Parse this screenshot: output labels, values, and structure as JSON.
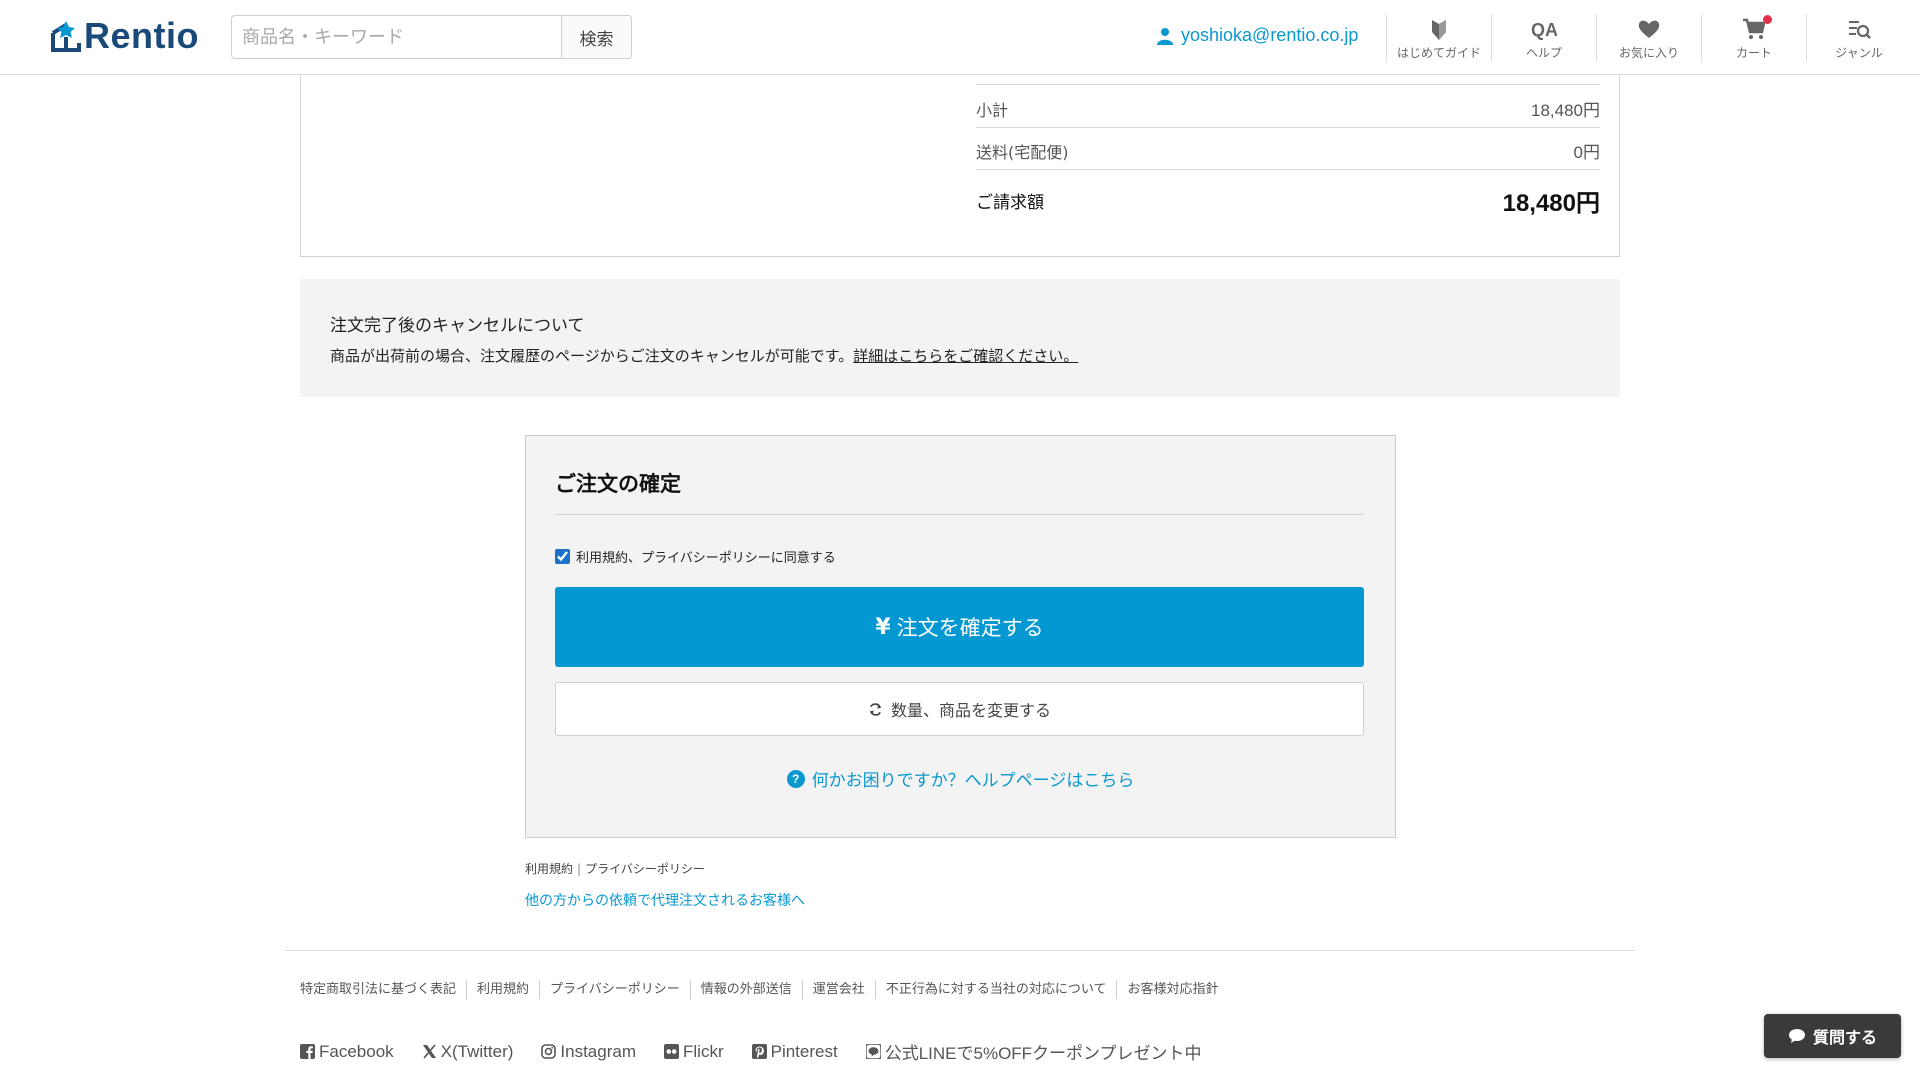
{
  "header": {
    "logo_text": "Rentio",
    "search_placeholder": "商品名・キーワード",
    "search_button": "検索",
    "user_email": "yoshioka@rentio.co.jp",
    "nav": [
      {
        "label": "はじめてガイド",
        "icon": "beginner-guide-icon"
      },
      {
        "label": "ヘルプ",
        "icon": "qa-icon"
      },
      {
        "label": "お気に入り",
        "icon": "heart-icon"
      },
      {
        "label": "カート",
        "icon": "cart-icon"
      },
      {
        "label": "ジャンル",
        "icon": "genre-search-icon"
      }
    ]
  },
  "summary": {
    "subtotal_label": "小計",
    "subtotal_value": "18,480円",
    "shipping_label": "送料(宅配便)",
    "shipping_value": "0円",
    "total_label": "ご請求額",
    "total_value": "18,480円"
  },
  "notice": {
    "title": "注文完了後のキャンセルについて",
    "text": "商品が出荷前の場合、注文履歴のページからご注文のキャンセルが可能です。",
    "link": "詳細はこちらをご確認ください。"
  },
  "confirm": {
    "title": "ご注文の確定",
    "agree_label": "利用規約、プライバシーポリシーに同意する",
    "agree_checked": true,
    "confirm_button": "注文を確定する",
    "change_button": "数量、商品を変更する",
    "help_link": "何かお困りですか？ヘルプページはこちら"
  },
  "terms": {
    "terms_link": "利用規約",
    "privacy_link": "プライバシーポリシー",
    "proxy_link": "他の方からの依頼で代理注文されるお客様へ"
  },
  "footer": {
    "links": [
      "特定商取引法に基づく表記",
      "利用規約",
      "プライバシーポリシー",
      "情報の外部送信",
      "運営会社",
      "不正行為に対する当社の対応について",
      "お客様対応指針"
    ],
    "social": [
      {
        "label": "Facebook",
        "icon": "facebook-icon"
      },
      {
        "label": "X(Twitter)",
        "icon": "x-twitter-icon"
      },
      {
        "label": "Instagram",
        "icon": "instagram-icon"
      },
      {
        "label": "Flickr",
        "icon": "flickr-icon"
      },
      {
        "label": "Pinterest",
        "icon": "pinterest-icon"
      },
      {
        "label": "公式LINEで5%OFFクーポンプレゼント中",
        "icon": "line-icon"
      }
    ]
  },
  "chat_button": "質問する",
  "colors": {
    "accent": "#0498d3",
    "link": "#0a98d0",
    "logo": "#1a4a7a",
    "notice_bg": "#f2f3f5",
    "cart_badge": "#e0334a"
  }
}
